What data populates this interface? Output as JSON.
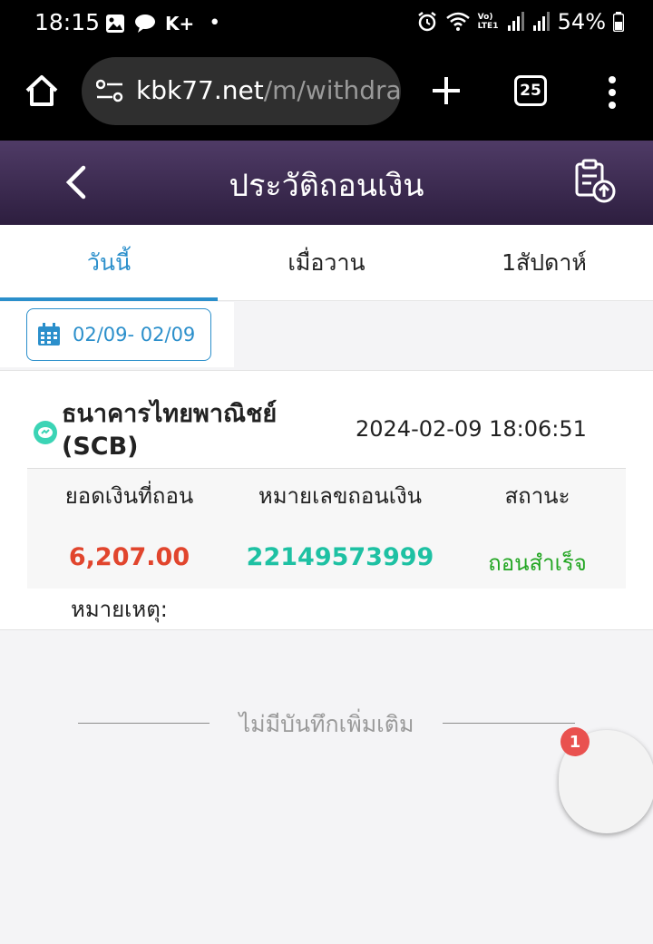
{
  "status_bar": {
    "time": "18:15",
    "k_plus": "K+",
    "dot": "•",
    "network": "Vo) LTE1",
    "battery": "54%"
  },
  "browser": {
    "url_domain": "kbk77.net",
    "url_path": "/m/withdra",
    "tab_count": "25"
  },
  "header": {
    "title": "ประวัติถอนเงิน"
  },
  "tabs": [
    {
      "label": "วันนี้",
      "active": true
    },
    {
      "label": "เมื่อวาน",
      "active": false
    },
    {
      "label": "1สัปดาห์",
      "active": false
    }
  ],
  "filter": {
    "date_range": "02/09- 02/09"
  },
  "record": {
    "bank_name": "ธนาคารไทยพาณิชย์ (SCB)",
    "datetime": "2024-02-09 18:06:51",
    "amount_label": "ยอดเงินที่ถอน",
    "number_label": "หมายเลขถอนเงิน",
    "status_label": "สถานะ",
    "amount": "6,207.00",
    "number": "22149573999",
    "status": "ถอนสำเร็จ",
    "remark_label": "หมายเหตุ:"
  },
  "footer": {
    "no_more": "ไม่มีบันทึกเพิ่มเติม"
  },
  "fab": {
    "badge": "1"
  },
  "colors": {
    "accent": "#2b8fcb",
    "amount": "#e1452d",
    "number": "#1ec1a3",
    "success": "#23a623",
    "header_top": "#4f3b66",
    "header_bottom": "#2d1e3f",
    "badge": "#e9514f"
  }
}
